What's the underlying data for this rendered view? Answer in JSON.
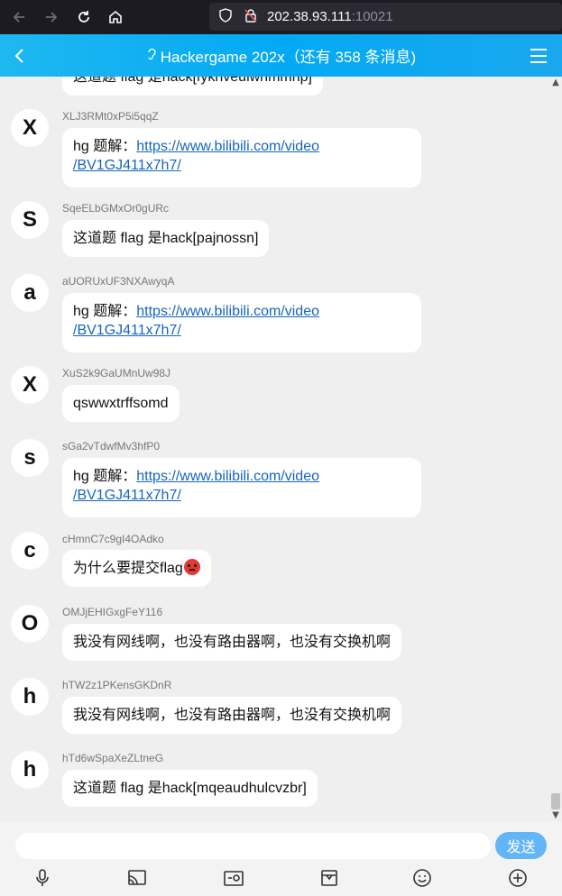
{
  "browser": {
    "url_host": "202.38.93.111",
    "url_port": ":10021"
  },
  "header": {
    "title": "Hackergame 202x（还有 358 条消息)"
  },
  "messages": [
    {
      "avatar": "",
      "sender": "",
      "text": "这道题 flag 是hack[fykhveulwhmmnp]"
    },
    {
      "avatar": "X",
      "sender": "XLJ3RMt0xP5i5qqZ",
      "prefix": "hg 题解：",
      "link1": "https://www.bilibili.com/video",
      "link2": "/BV1GJ411x7h7/"
    },
    {
      "avatar": "S",
      "sender": "SqeELbGMxOr0gURc",
      "text": "这道题 flag 是hack[pajnossn]"
    },
    {
      "avatar": "a",
      "sender": "aUORUxUF3NXAwyqA",
      "prefix": "hg 题解：",
      "link1": "https://www.bilibili.com/video",
      "link2": "/BV1GJ411x7h7/"
    },
    {
      "avatar": "X",
      "sender": "XuS2k9GaUMnUw98J",
      "text": "qswwxtrffsomd"
    },
    {
      "avatar": "s",
      "sender": "sGa2vTdwfMv3hfP0",
      "prefix": "hg 题解：",
      "link1": "https://www.bilibili.com/video",
      "link2": "/BV1GJ411x7h7/"
    },
    {
      "avatar": "c",
      "sender": "cHmnC7c9gI4OAdko",
      "text": "为什么要提交flag"
    },
    {
      "avatar": "O",
      "sender": "OMJjEHIGxgFeY116",
      "text": "我没有网线啊，也没有路由器啊，也没有交换机啊"
    },
    {
      "avatar": "h",
      "sender": "hTW2z1PKensGKDnR",
      "text": "我没有网线啊，也没有路由器啊，也没有交换机啊"
    },
    {
      "avatar": "h",
      "sender": "hTd6wSpaXeZLtneG",
      "text": "这道题 flag 是hack[mqeaudhulcvzbr]"
    }
  ],
  "input": {
    "placeholder": "",
    "send_label": "发送"
  },
  "toolbar": [
    {
      "icon": "microphone-icon"
    },
    {
      "icon": "cast-icon"
    },
    {
      "icon": "image-icon"
    },
    {
      "icon": "box-icon"
    },
    {
      "icon": "smiley-icon"
    },
    {
      "icon": "add-icon"
    }
  ]
}
